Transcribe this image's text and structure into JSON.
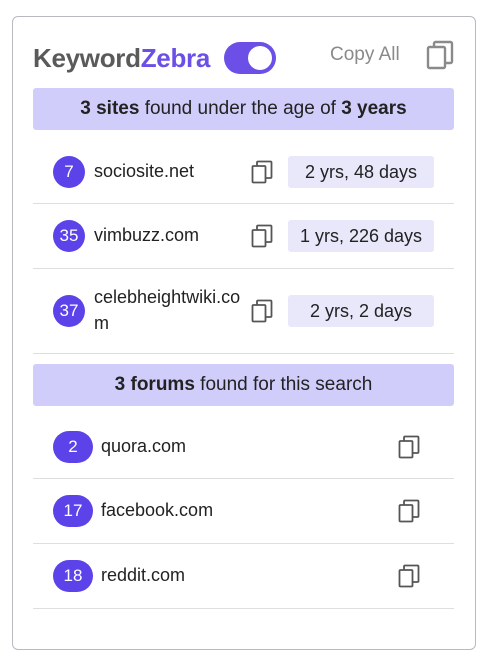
{
  "brand": {
    "part1": "Keyword",
    "part2": "Zebra",
    "toggle_on": true
  },
  "header": {
    "copy_all_label": "Copy All"
  },
  "colors": {
    "accent": "#6b4fe6",
    "banner": "#d0cdfb",
    "age_pill": "#e9e8fb"
  },
  "sites_banner": {
    "count": "3 sites",
    "middle": " found under the age of ",
    "age": "3 years"
  },
  "sites": [
    {
      "rank": "7",
      "name": "sociosite.net",
      "age": "2 yrs, 48 days"
    },
    {
      "rank": "35",
      "name": "vimbuzz.com",
      "age": "1 yrs, 226 days"
    },
    {
      "rank": "37",
      "name_line1": "celebheightwiki.co",
      "name_line2": "m",
      "age": "2 yrs, 2 days"
    }
  ],
  "forums_banner": {
    "count": "3 forums",
    "rest": " found for this search"
  },
  "forums": [
    {
      "rank": "2",
      "name": "quora.com"
    },
    {
      "rank": "17",
      "name": "facebook.com"
    },
    {
      "rank": "18",
      "name": "reddit.com"
    }
  ],
  "icons": {
    "copy": "copy-icon"
  }
}
